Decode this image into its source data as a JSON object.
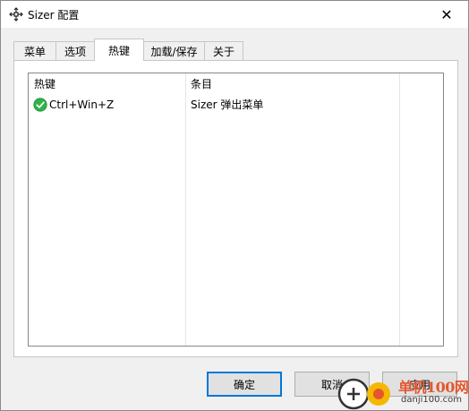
{
  "window": {
    "title": "Sizer 配置",
    "close_glyph": "✕",
    "app_icon": "move-arrows-icon"
  },
  "tabs": [
    {
      "label": "菜单",
      "active": false
    },
    {
      "label": "选项",
      "active": false
    },
    {
      "label": "热键",
      "active": true
    },
    {
      "label": "加载/保存",
      "active": false
    },
    {
      "label": "关于",
      "active": false
    }
  ],
  "hotkeys_list": {
    "columns": [
      "热键",
      "条目"
    ],
    "rows": [
      {
        "status_icon": "check-circle-icon",
        "hotkey": "Ctrl+Win+Z",
        "item": "Sizer 弹出菜单"
      }
    ]
  },
  "buttons": {
    "ok": "确定",
    "cancel": "取消",
    "apply": "应用"
  },
  "watermark": {
    "brand": "单机100网",
    "domain": "danji100.com"
  },
  "colors": {
    "accent": "#0078d7",
    "check_green": "#2fb34a",
    "watermark_red": "#e4572e",
    "watermark_yellow": "#f5b800"
  }
}
